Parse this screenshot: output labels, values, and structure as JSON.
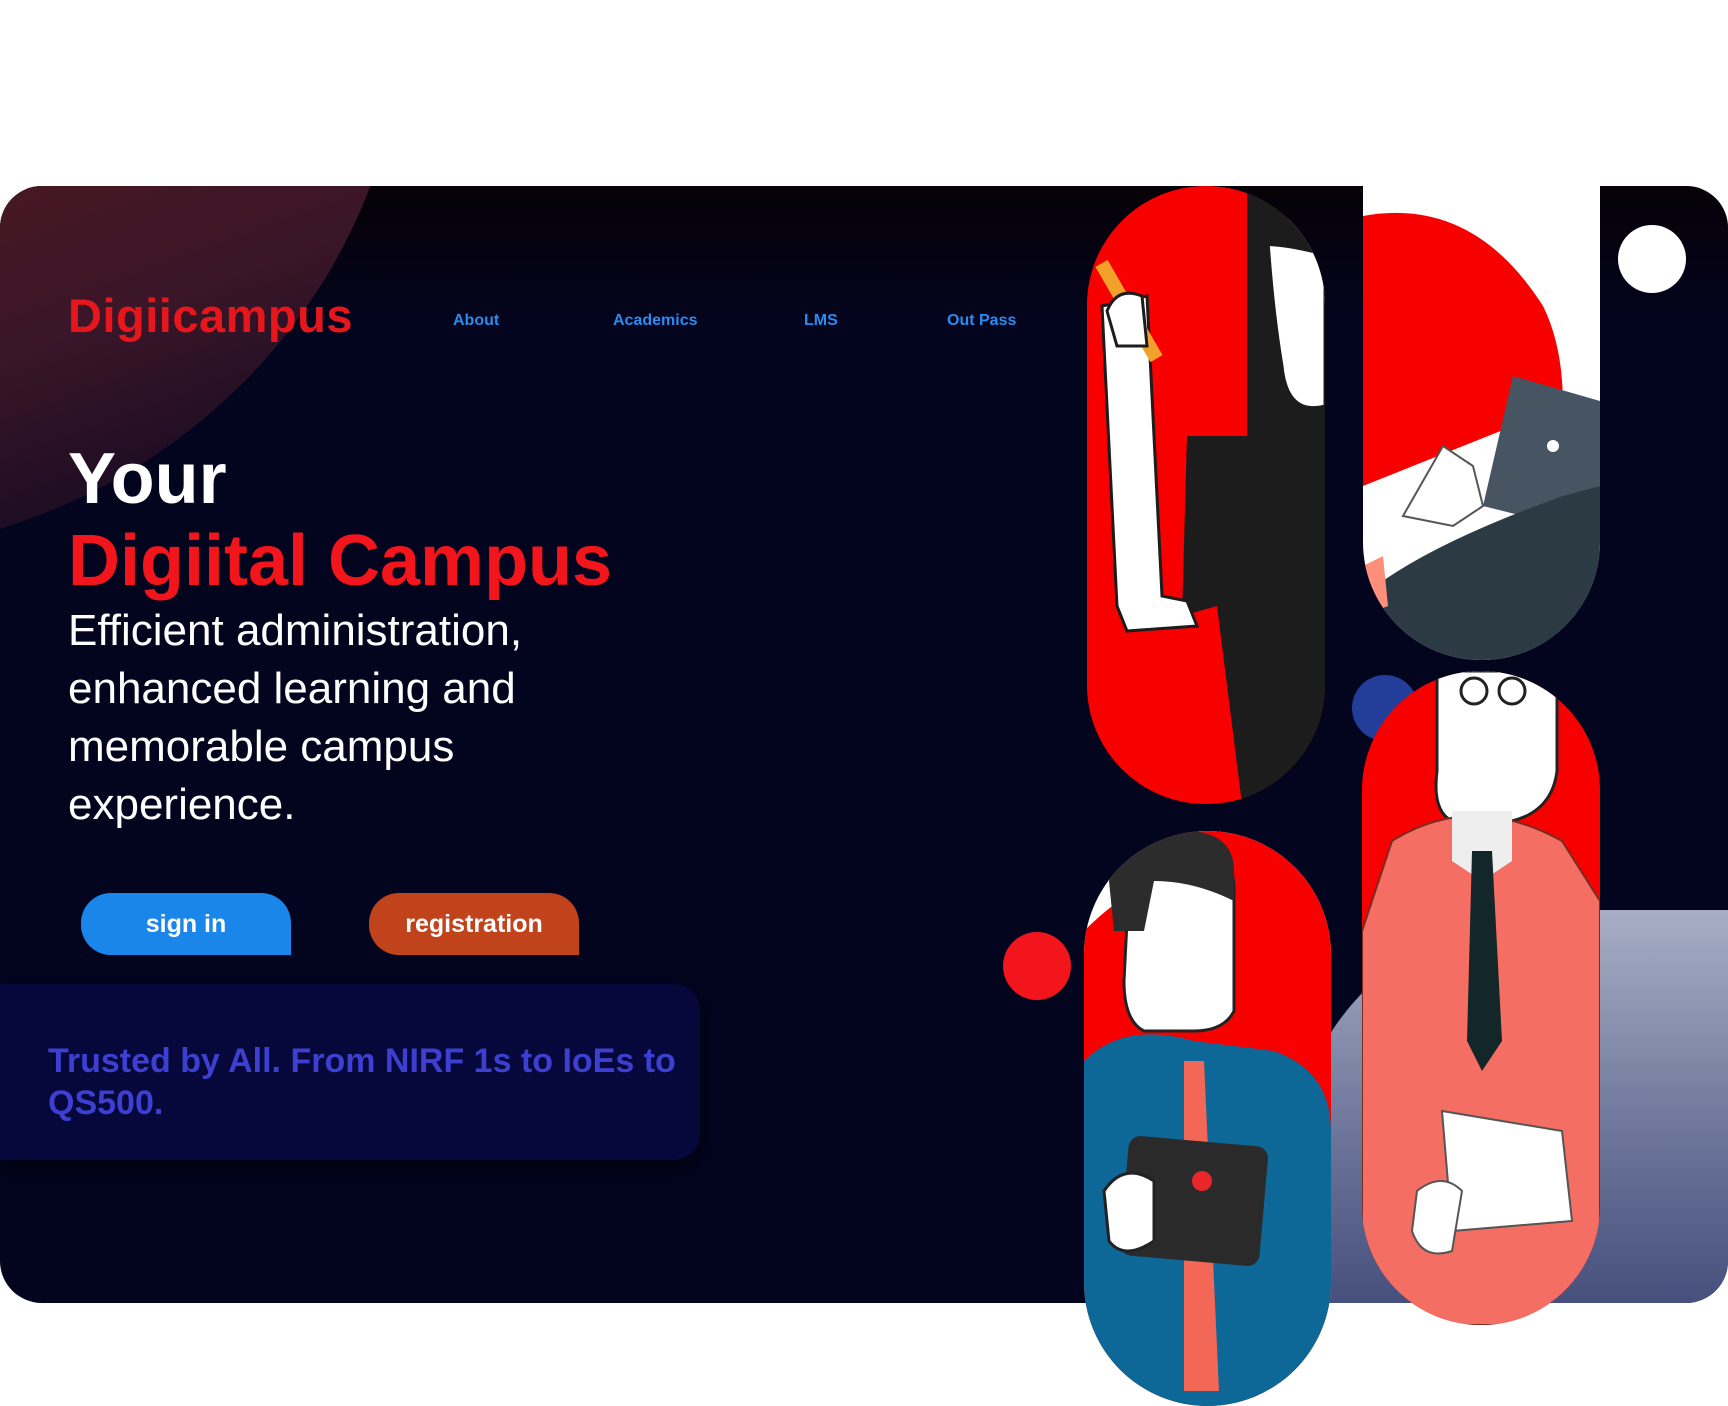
{
  "brand": {
    "logo": "Digiicampus"
  },
  "nav": {
    "items": [
      "About",
      "Academics",
      "LMS",
      "Out Pass"
    ]
  },
  "hero": {
    "title_line1": "Your",
    "title_line2": "Digiital Campus",
    "subtitle": "Efficient administration, enhanced learning and memorable campus experience."
  },
  "buttons": {
    "signin": "sign in",
    "registration": "registration"
  },
  "trust": {
    "text": "Trusted by All. From NIRF 1s to IoEs to QS500."
  },
  "colors": {
    "background": "#03041e",
    "brand_red": "#e5171c",
    "nav_blue": "#2a8cf0",
    "signin_blue": "#1b86ea",
    "registration_orange": "#c1431b",
    "trust_text": "#3c3fd0"
  }
}
